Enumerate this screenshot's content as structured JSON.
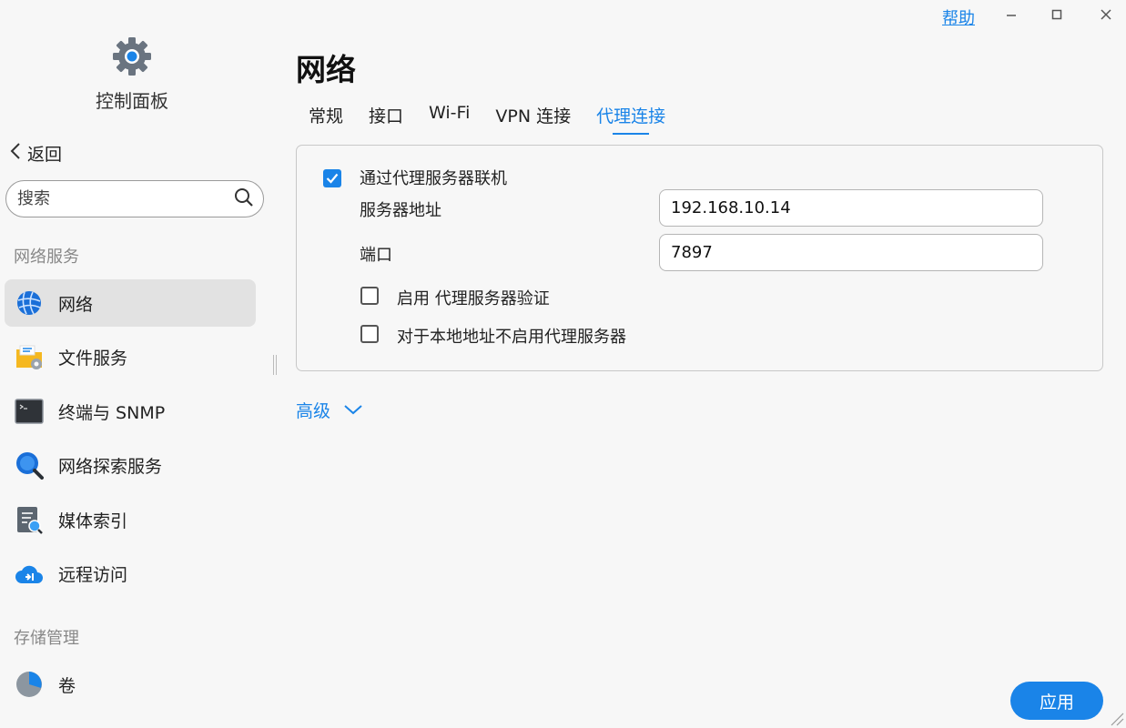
{
  "window": {
    "help_label": "帮助",
    "icons": [
      "minimize-icon",
      "maximize-icon",
      "close-icon"
    ]
  },
  "sidebar": {
    "brand_title": "控制面板",
    "back_label": "返回",
    "search_placeholder": "搜索",
    "section_network": "网络服务",
    "items": [
      {
        "label": "网络",
        "icon": "globe-icon"
      },
      {
        "label": "文件服务",
        "icon": "folder-gear-icon"
      },
      {
        "label": "终端与 SNMP",
        "icon": "terminal-icon"
      },
      {
        "label": "网络探索服务",
        "icon": "discovery-icon"
      },
      {
        "label": "媒体索引",
        "icon": "media-index-icon"
      },
      {
        "label": "远程访问",
        "icon": "cloud-icon"
      }
    ],
    "section_storage": "存储管理",
    "storage_items": [
      {
        "label": "卷",
        "icon": "volume-icon"
      }
    ]
  },
  "main": {
    "title": "网络",
    "tabs": [
      {
        "label": "常规"
      },
      {
        "label": "接口"
      },
      {
        "label": "Wi-Fi"
      },
      {
        "label": "VPN 连接"
      },
      {
        "label": "代理连接"
      }
    ],
    "active_tab": "代理连接",
    "proxy": {
      "use_proxy_label": "通过代理服务器联机",
      "use_proxy_checked": true,
      "server_label": "服务器地址",
      "server_value": "192.168.10.14",
      "port_label": "端口",
      "port_value": "7897",
      "auth_label": "启用 代理服务器验证",
      "auth_checked": false,
      "bypass_label": "对于本地地址不启用代理服务器",
      "bypass_checked": false
    },
    "advanced_label": "高级",
    "apply_label": "应用"
  },
  "colors": {
    "accent": "#1a84e8",
    "active_nav_bg": "#e2e2e2"
  }
}
